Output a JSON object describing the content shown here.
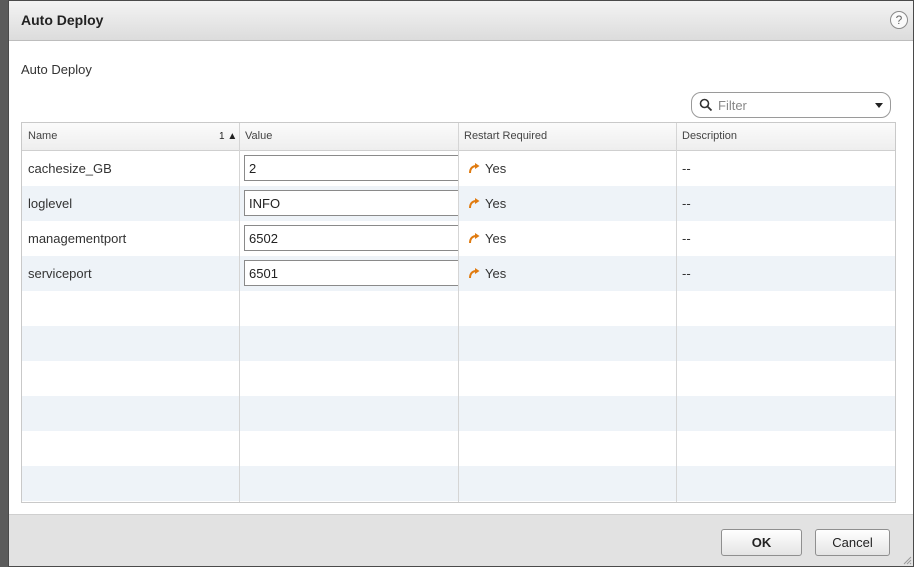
{
  "dialog": {
    "title": "Auto Deploy",
    "help_glyph": "?",
    "section_label": "Auto Deploy"
  },
  "filter": {
    "placeholder": "Filter",
    "value": ""
  },
  "table": {
    "columns": {
      "name": "Name",
      "sort_order": "1 ▲",
      "value": "Value",
      "restart": "Restart Required",
      "description": "Description"
    },
    "rows": [
      {
        "name": "cachesize_GB",
        "value": "2",
        "restart": "Yes",
        "description": "--"
      },
      {
        "name": "loglevel",
        "value": "INFO",
        "restart": "Yes",
        "description": "--"
      },
      {
        "name": "managementport",
        "value": "6502",
        "restart": "Yes",
        "description": "--"
      },
      {
        "name": "serviceport",
        "value": "6501",
        "restart": "Yes",
        "description": "--"
      }
    ]
  },
  "buttons": {
    "ok": "OK",
    "cancel": "Cancel"
  },
  "icons": {
    "help": "help-icon",
    "search": "search-icon",
    "dropdown": "chevron-down-icon",
    "restart": "restart-arrow-icon",
    "resize": "resize-grip-icon"
  },
  "colors": {
    "alt_row": "#eef3f8",
    "restart_icon": "#e07b10",
    "footer": "#e2e2e2"
  }
}
